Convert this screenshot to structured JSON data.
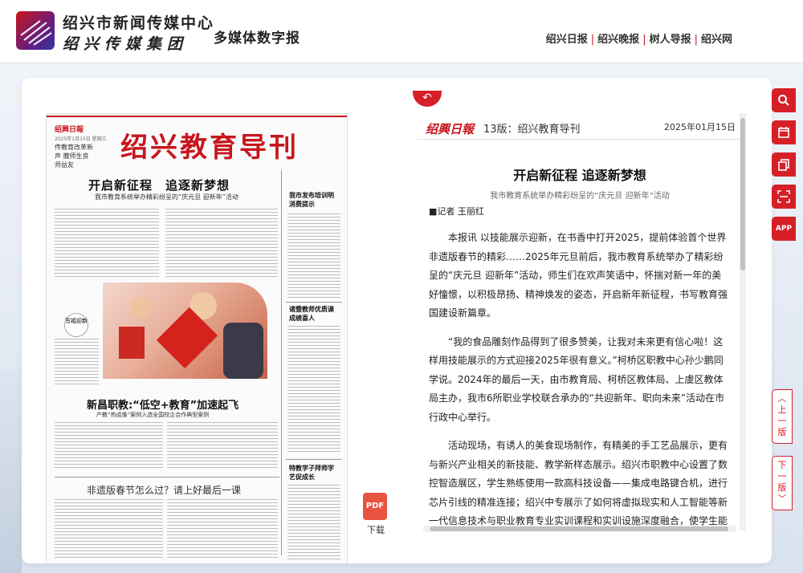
{
  "header": {
    "org_name": "绍兴市新闻传媒中心",
    "org_group": "绍兴传媒集团",
    "site_title": "多媒体数字报",
    "nav": [
      "绍兴日报",
      "绍兴晚报",
      "树人导报",
      "绍兴网"
    ]
  },
  "newspaper_page": {
    "masthead": "绍興日報",
    "date": "2025年1月15日 星期三",
    "slogan": "传教育改革新声 撒师生良师益友",
    "section_title": "绍兴教育导刊",
    "headline_1": "开启新征程　追逐新梦想",
    "subhead_1": "我市教育系统举办精彩纷呈的“庆元旦 迎新年”活动",
    "photo_caption": "写福迎新",
    "headline_2": "新昌职教:“低空+教育”加速起飞",
    "subhead_2": "产教“热成像”案例入选全国校企合作典型案例",
    "headline_3": "非遗版春节怎么过？请上好最后一课",
    "side_heads": [
      "我市发布培训明消费提示",
      "诸暨教师优质课成绩喜人",
      "特教学子拜师学艺促成长"
    ]
  },
  "pdf": {
    "label": "下载",
    "icon_text": "PDF"
  },
  "article": {
    "paper_logo": "绍興日報",
    "page_label": "13版：绍兴教育导刊",
    "date": "2025年01月15日",
    "title": "开启新征程 追逐新梦想",
    "subtitle": "我市教育系统举办精彩纷呈的“庆元旦 迎新年”活动",
    "author": "■记者 王丽红",
    "paragraphs": [
      "本报讯 以技能展示迎新，在书香中打开2025，提前体验首个世界非遗版春节的精彩……2025年元旦前后，我市教育系统举办了精彩纷呈的“庆元旦 迎新年”活动，师生们在欢声笑语中，怀揣对新一年的美好憧憬，以积极昂扬、精神焕发的姿态，开启新年新征程，书写教育强国建设新篇章。",
      "“我的食品雕刻作品得到了很多赞美，让我对未来更有信心啦！这样用技能展示的方式迎接2025年很有意义。”柯桥区职教中心孙少鹏同学说。2024年的最后一天，由市教育局、柯桥区教体局、上虞区教体局主办，我市6所职业学校联合承办的“共迎新年、职向未来”活动在市行政中心举行。",
      "活动现场，有诱人的美食现场制作，有精美的手工艺品展示，更有与新兴产业相关的新技能、教学新样态展示。绍兴市职教中心设置了数控智造展区，学生熟练使用一款高科技设备——集成电路键合机，进行芯片引线的精准连接；绍兴中专展示了如何将虚拟现实和人工智能等新一代信息技术与职业教育专业实训课程和实训设施深度融合，使学生能在高度拟真的实践教学环境中，深入理解专业的核心知"
    ]
  },
  "tools": {
    "search": "search-icon",
    "calendar": "calendar-icon",
    "copy": "copy-icon",
    "scan": "scan-icon",
    "app_label": "APP",
    "prev_page": "上一版",
    "next_page": "下一版"
  },
  "colors": {
    "accent": "#d61f26",
    "title_red": "#c8161d"
  }
}
